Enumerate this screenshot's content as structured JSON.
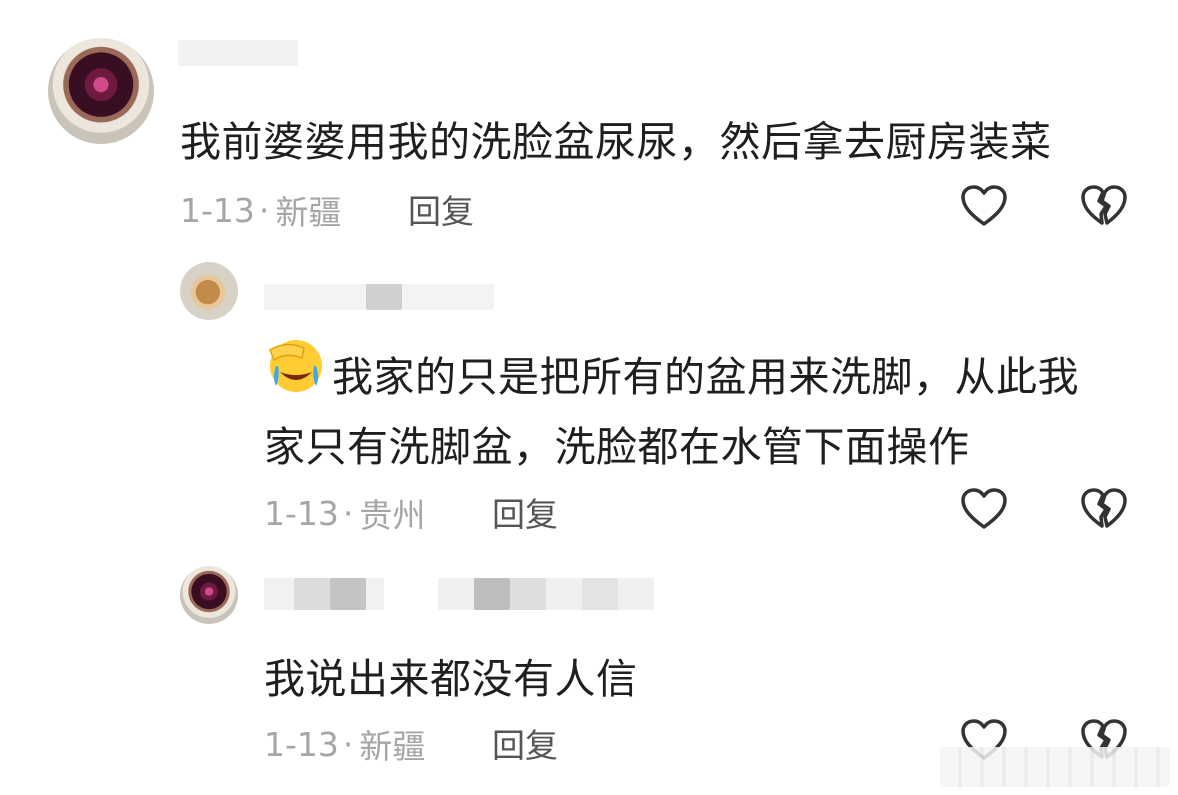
{
  "comments": [
    {
      "text": "我前婆婆用我的洗脸盆尿尿，然后拿去厨房装菜",
      "date": "1-13",
      "location": "新疆",
      "reply_label": "回复"
    },
    {
      "text_line1": "我家的只是把所有的盆用来洗脚，从此我",
      "text_line2": "家只有洗脚盆，洗脸都在水管下面操作",
      "date": "1-13",
      "location": "贵州",
      "reply_label": "回复"
    },
    {
      "text": "我说出来都没有人信",
      "date": "1-13",
      "location": "新疆",
      "reply_label": "回复"
    }
  ],
  "separator": "·",
  "icons": {
    "like": "heart-outline-icon",
    "dislike": "broken-heart-icon",
    "emoji": "facepalm-crying-emoji"
  },
  "colors": {
    "text": "#1f1f1f",
    "meta": "#a6a6a6",
    "icon_stroke": "#333333"
  }
}
